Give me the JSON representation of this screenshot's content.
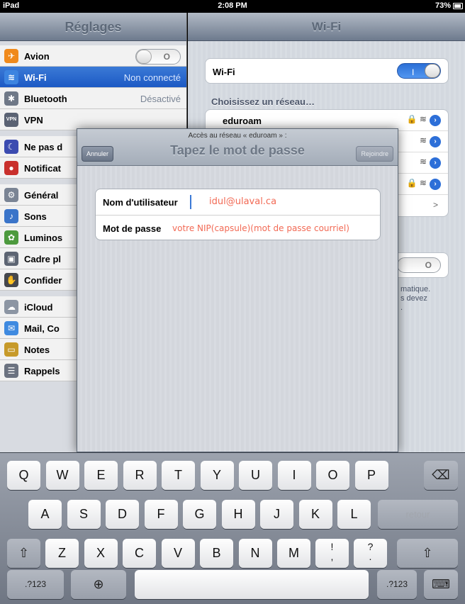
{
  "status_bar": {
    "device": "iPad",
    "time": "2:08 PM",
    "battery": "73%"
  },
  "sidebar": {
    "title": "Réglages",
    "items": [
      {
        "name": "airplane",
        "label": "Avion",
        "value": "",
        "icon": "✈",
        "icon_color": "#f08a1c",
        "toggle_value": "O"
      },
      {
        "name": "wifi",
        "label": "Wi-Fi",
        "value": "Non connecté",
        "icon": "≋",
        "icon_color": "#3c84e0"
      },
      {
        "name": "bluetooth",
        "label": "Bluetooth",
        "value": "Désactivé",
        "icon": "✱",
        "icon_color": "#6f7887"
      },
      {
        "name": "vpn",
        "label": "VPN",
        "value": "",
        "icon": "VPN",
        "icon_color": "#5a6273"
      },
      {
        "name": "dnd",
        "label": "Ne pas d",
        "value": "",
        "icon": "☾",
        "icon_color": "#3b4bb0"
      },
      {
        "name": "notifications",
        "label": "Notificat",
        "value": "",
        "icon": "●",
        "icon_color": "#c9302c"
      },
      {
        "name": "general",
        "label": "Général",
        "value": "",
        "icon": "⚙",
        "icon_color": "#7a8494"
      },
      {
        "name": "sounds",
        "label": "Sons",
        "value": "",
        "icon": "♪",
        "icon_color": "#3a74c9"
      },
      {
        "name": "brightness",
        "label": "Luminos",
        "value": "",
        "icon": "✿",
        "icon_color": "#4d9a3e"
      },
      {
        "name": "picture-frame",
        "label": "Cadre pl",
        "value": "",
        "icon": "▣",
        "icon_color": "#5d6573"
      },
      {
        "name": "privacy",
        "label": "Confider",
        "value": "",
        "icon": "✋",
        "icon_color": "#45474d"
      },
      {
        "name": "icloud",
        "label": "iCloud",
        "value": "",
        "icon": "☁",
        "icon_color": "#8c95a3"
      },
      {
        "name": "mail",
        "label": "Mail, Co",
        "value": "",
        "icon": "✉",
        "icon_color": "#3f8ae0"
      },
      {
        "name": "notes",
        "label": "Notes",
        "value": "",
        "icon": "▭",
        "icon_color": "#c79a2a"
      },
      {
        "name": "reminders",
        "label": "Rappels",
        "value": "",
        "icon": "☰",
        "icon_color": "#6b7280"
      }
    ]
  },
  "detail": {
    "title": "Wi-Fi",
    "wifi_label": "Wi-Fi",
    "wifi_toggle": "I",
    "choose_network": "Choisissez un réseau…",
    "networks": [
      {
        "name": "eduroam",
        "icons": "🔒 ≋"
      },
      {
        "name": "",
        "icons": "≋"
      },
      {
        "name": "",
        "icons": "≋"
      },
      {
        "name": "",
        "icons": "🔒 ≋"
      }
    ],
    "other_chevron": ">",
    "ask_toggle": "O",
    "footnote_lines": [
      "matique.",
      "s devez",
      "."
    ]
  },
  "modal": {
    "prompt": "Accès au réseau « eduroam » :",
    "title": "Tapez le mot de passe",
    "cancel": "Annuler",
    "join": "Rejoindre",
    "username_label": "Nom d'utilisateur",
    "username_hint": "idul@ulaval.ca",
    "password_label": "Mot de passe",
    "password_hint": "votre NIP(capsule)(mot de passe courriel)"
  },
  "keyboard": {
    "row1": [
      "Q",
      "W",
      "E",
      "R",
      "T",
      "Y",
      "U",
      "I",
      "O",
      "P"
    ],
    "row2": [
      "A",
      "S",
      "D",
      "F",
      "G",
      "H",
      "J",
      "K",
      "L"
    ],
    "row3": [
      "Z",
      "X",
      "C",
      "V",
      "B",
      "N",
      "M"
    ],
    "return": "retour",
    "numbers": ".?123",
    "delete_icon": "⌫",
    "shift_icon": "⇧",
    "globe_icon": "⊕",
    "hide_icon": "⌨",
    "exclam_top": "!",
    "exclam_bottom": ",",
    "question_top": "?",
    "question_bottom": "."
  }
}
